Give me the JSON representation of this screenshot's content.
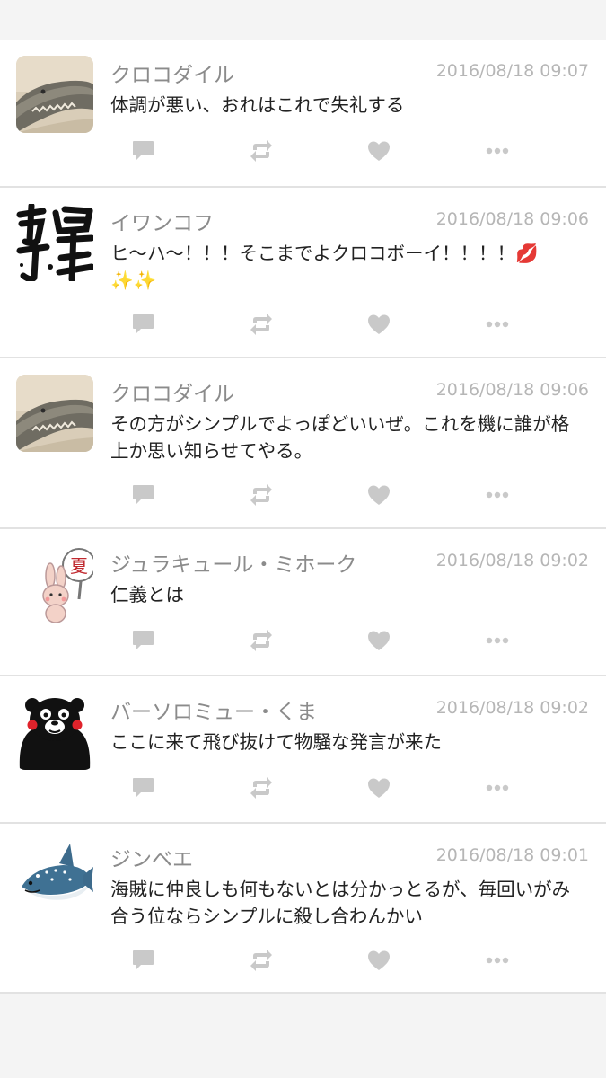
{
  "posts": [
    {
      "name": "クロコダイル",
      "time": "2016/08/18 09:07",
      "text": "体調が悪い、おれはこれで失礼する",
      "avatar": "crocodile-photo"
    },
    {
      "name": "イワンコフ",
      "time": "2016/08/18 09:06",
      "text": "ヒ〜ハ〜！！！そこまでよクロコボーイ！！！！💋✨✨",
      "avatar": "calligraphy-kiseki"
    },
    {
      "name": "クロコダイル",
      "time": "2016/08/18 09:06",
      "text": "その方がシンプルでよっぽどいいぜ。これを機に誰が格上か思い知らせてやる。",
      "avatar": "crocodile-photo"
    },
    {
      "name": "ジュラキュール・ミホーク",
      "time": "2016/08/18 09:02",
      "text": "仁義とは",
      "avatar": "bunny-with-fan"
    },
    {
      "name": "バーソロミュー・くま",
      "time": "2016/08/18 09:02",
      "text": "ここに来て飛び抜けて物騒な発言が来た",
      "avatar": "black-bear-mascot"
    },
    {
      "name": "ジンベエ",
      "time": "2016/08/18 09:01",
      "text": "海賊に仲良しも何もないとは分かっとるが、毎回いがみ合う位ならシンプルに殺し合わんかい",
      "avatar": "whale-shark"
    }
  ],
  "icons": {
    "reply": "comment-icon",
    "retweet": "repost-icon",
    "like": "heart-icon",
    "more": "more-icon"
  },
  "colors": {
    "icon": "#c9c9c9",
    "name": "#8b8b8b",
    "time": "#b6b6b6",
    "text": "#222222",
    "divider": "#e2e2e2",
    "background": "#f4f4f4"
  }
}
